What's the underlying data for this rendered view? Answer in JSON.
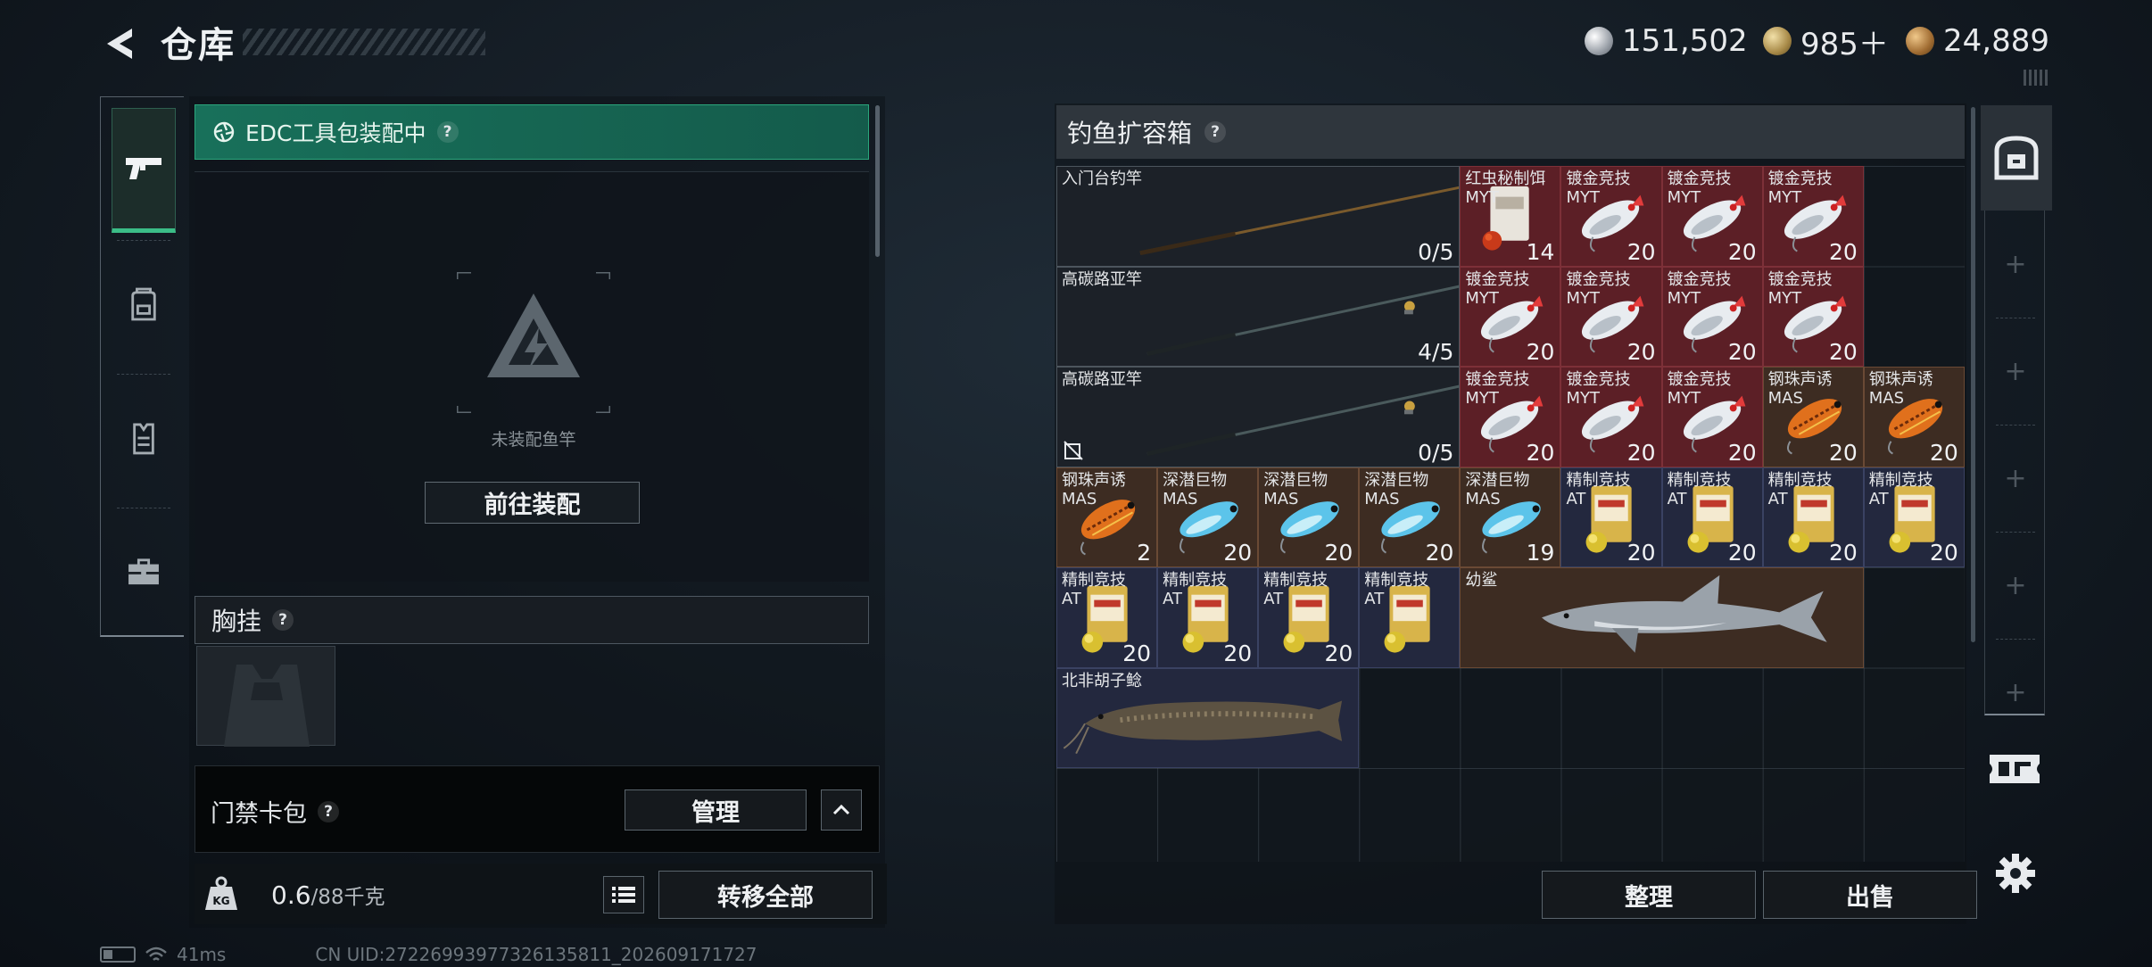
{
  "header": {
    "title": "仓库",
    "currencies": [
      {
        "name": "silver-coin",
        "value": "151,502",
        "color": "#c8ccd2"
      },
      {
        "name": "gold-triangle",
        "value": "985＋",
        "color": "#b69a56"
      },
      {
        "name": "bronze-coin",
        "value": "24,889",
        "color": "#a87a3c"
      }
    ]
  },
  "left_rail": {
    "items": [
      {
        "icon": "pistol-icon",
        "active": true
      },
      {
        "icon": "backpack-icon",
        "active": false
      },
      {
        "icon": "vest-icon",
        "active": false
      },
      {
        "icon": "toolbox-icon",
        "active": false
      }
    ]
  },
  "edc": {
    "label": "EDC工具包装配中",
    "help": "?"
  },
  "equip": {
    "empty_label": "未装配鱼竿",
    "button": "前往装配"
  },
  "chest": {
    "label": "胸挂",
    "help": "?"
  },
  "card_pack": {
    "label": "门禁卡包",
    "help": "?",
    "manage": "管理"
  },
  "weight": {
    "current": "0.6",
    "capacity": "/88千克",
    "transfer": "转移全部"
  },
  "status_bar": {
    "ping": "41ms",
    "uid": "CN UID:27226993977326135811_202609171727"
  },
  "box": {
    "title": "钓鱼扩容箱",
    "help": "?",
    "items": [
      {
        "name": "入门台钓竿",
        "sub": "",
        "qty": "0/5",
        "art": "rod-basic",
        "color": "gray",
        "cols": 4,
        "rows": 1
      },
      {
        "name": "红虫秘制饵",
        "sub": "MYT",
        "qty": "14",
        "art": "bait-bag",
        "color": "red",
        "cols": 1,
        "rows": 1
      },
      {
        "name": "镀金竞技",
        "sub": "MYT",
        "qty": "20",
        "art": "lure-silver",
        "color": "red",
        "cols": 1,
        "rows": 1
      },
      {
        "name": "镀金竞技",
        "sub": "MYT",
        "qty": "20",
        "art": "lure-silver",
        "color": "red",
        "cols": 1,
        "rows": 1
      },
      {
        "name": "镀金竞技",
        "sub": "MYT",
        "qty": "20",
        "art": "lure-silver",
        "color": "red",
        "cols": 1,
        "rows": 1
      },
      {
        "name": "高碳路亚竿",
        "sub": "",
        "qty": "4/5",
        "art": "rod-reel",
        "color": "gray",
        "cols": 4,
        "rows": 1
      },
      {
        "name": "镀金竞技",
        "sub": "MYT",
        "qty": "20",
        "art": "lure-silver",
        "color": "red",
        "cols": 1,
        "rows": 1
      },
      {
        "name": "镀金竞技",
        "sub": "MYT",
        "qty": "20",
        "art": "lure-silver",
        "color": "red",
        "cols": 1,
        "rows": 1
      },
      {
        "name": "镀金竞技",
        "sub": "MYT",
        "qty": "20",
        "art": "lure-silver",
        "color": "red",
        "cols": 1,
        "rows": 1
      },
      {
        "name": "镀金竞技",
        "sub": "MYT",
        "qty": "20",
        "art": "lure-silver",
        "color": "red",
        "cols": 1,
        "rows": 1
      },
      {
        "name": "高碳路亚竿",
        "sub": "",
        "qty": "0/5",
        "art": "rod-reel",
        "color": "gray",
        "cols": 4,
        "rows": 1,
        "unknown": true
      },
      {
        "name": "镀金竞技",
        "sub": "MYT",
        "qty": "20",
        "art": "lure-silver",
        "color": "red",
        "cols": 1,
        "rows": 1
      },
      {
        "name": "镀金竞技",
        "sub": "MYT",
        "qty": "20",
        "art": "lure-silver",
        "color": "red",
        "cols": 1,
        "rows": 1
      },
      {
        "name": "镀金竞技",
        "sub": "MYT",
        "qty": "20",
        "art": "lure-silver",
        "color": "red",
        "cols": 1,
        "rows": 1
      },
      {
        "name": "钢珠声诱",
        "sub": "MAS",
        "qty": "20",
        "art": "lure-orange",
        "color": "brown",
        "cols": 1,
        "rows": 1
      },
      {
        "name": "钢珠声诱",
        "sub": "MAS",
        "qty": "20",
        "art": "lure-orange",
        "color": "brown",
        "cols": 1,
        "rows": 1
      },
      {
        "name": "钢珠声诱",
        "sub": "MAS",
        "qty": "2",
        "art": "lure-orange",
        "color": "brown",
        "cols": 1,
        "rows": 1
      },
      {
        "name": "深潜巨物",
        "sub": "MAS",
        "qty": "20",
        "art": "lure-blue",
        "color": "brown",
        "cols": 1,
        "rows": 1
      },
      {
        "name": "深潜巨物",
        "sub": "MAS",
        "qty": "20",
        "art": "lure-blue",
        "color": "brown",
        "cols": 1,
        "rows": 1
      },
      {
        "name": "深潜巨物",
        "sub": "MAS",
        "qty": "20",
        "art": "lure-blue",
        "color": "brown",
        "cols": 1,
        "rows": 1
      },
      {
        "name": "深潜巨物",
        "sub": "MAS",
        "qty": "19",
        "art": "lure-blue",
        "color": "brown",
        "cols": 1,
        "rows": 1
      },
      {
        "name": "精制竞技",
        "sub": "AT",
        "qty": "20",
        "art": "bait-gold",
        "color": "blue",
        "cols": 1,
        "rows": 1
      },
      {
        "name": "精制竞技",
        "sub": "AT",
        "qty": "20",
        "art": "bait-gold",
        "color": "blue",
        "cols": 1,
        "rows": 1
      },
      {
        "name": "精制竞技",
        "sub": "AT",
        "qty": "20",
        "art": "bait-gold",
        "color": "blue",
        "cols": 1,
        "rows": 1
      },
      {
        "name": "精制竞技",
        "sub": "AT",
        "qty": "20",
        "art": "bait-gold",
        "color": "blue",
        "cols": 1,
        "rows": 1
      },
      {
        "name": "精制竞技",
        "sub": "AT",
        "qty": "20",
        "art": "bait-gold",
        "color": "blue",
        "cols": 1,
        "rows": 1
      },
      {
        "name": "精制竞技",
        "sub": "AT",
        "qty": "20",
        "art": "bait-gold",
        "color": "blue",
        "cols": 1,
        "rows": 1
      },
      {
        "name": "精制竞技",
        "sub": "AT",
        "qty": "20",
        "art": "bait-gold",
        "color": "blue",
        "cols": 1,
        "rows": 1
      },
      {
        "name": "精制竞技",
        "sub": "AT",
        "qty": "",
        "art": "bait-gold",
        "color": "blue",
        "cols": 1,
        "rows": 1
      },
      {
        "name": "幼鲨",
        "sub": "",
        "qty": "",
        "art": "shark",
        "color": "brown",
        "cols": 4,
        "rows": 1
      },
      {
        "name": "北非胡子鲶",
        "sub": "",
        "qty": "",
        "art": "catfish",
        "color": "blue",
        "cols": 3,
        "rows": 1
      }
    ]
  },
  "actions": {
    "sort": "整理",
    "sell": "出售"
  },
  "right_rail": {
    "plus": [
      "+",
      "+",
      "+",
      "+",
      "+"
    ]
  }
}
